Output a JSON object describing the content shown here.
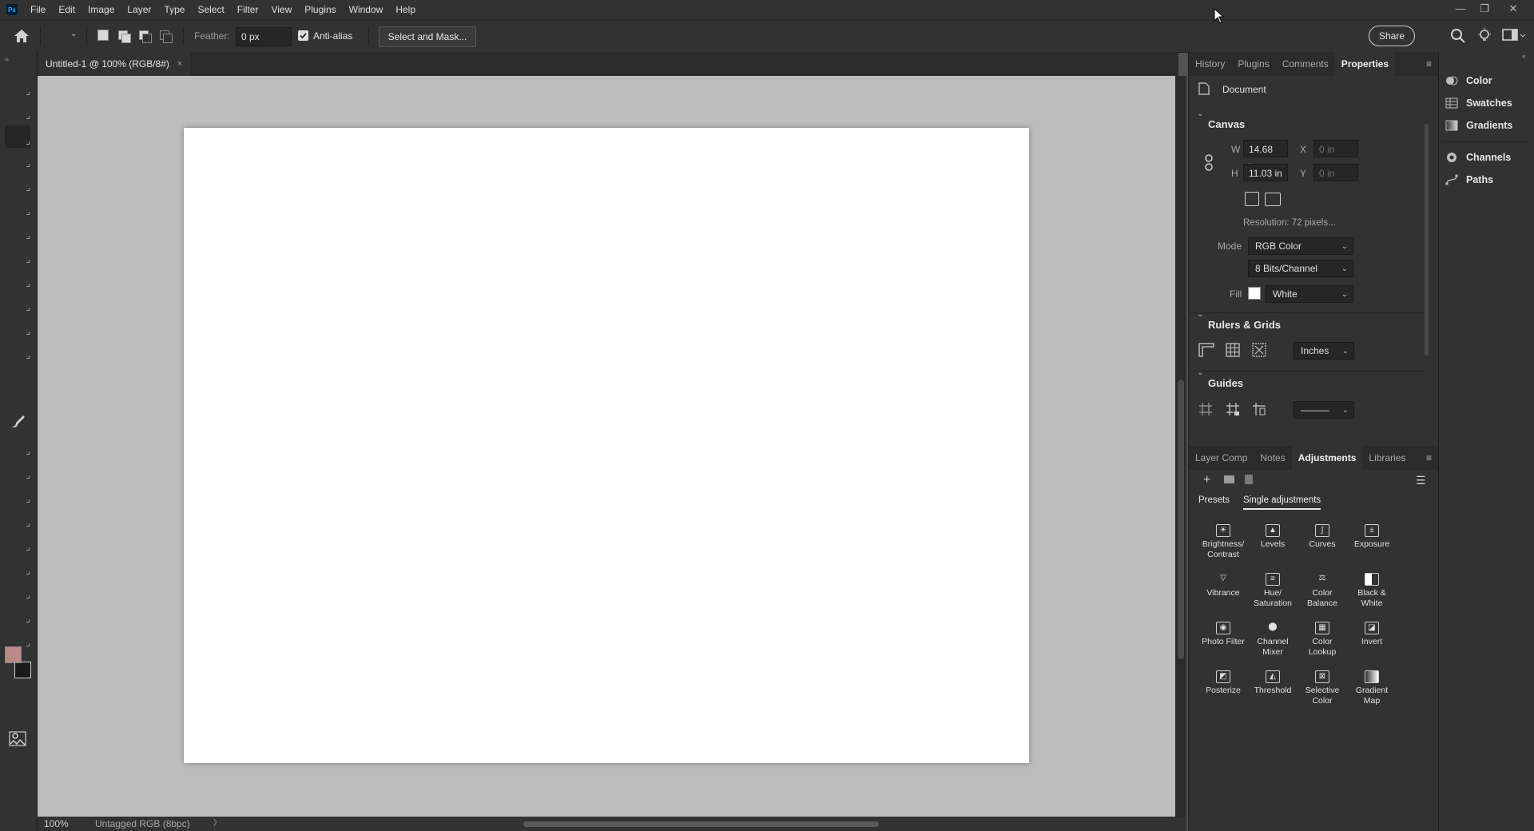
{
  "app": {
    "logo": "Ps"
  },
  "menu": [
    "File",
    "Edit",
    "Image",
    "Layer",
    "Type",
    "Select",
    "Filter",
    "View",
    "Plugins",
    "Window",
    "Help"
  ],
  "window_controls": {
    "minimize": "—",
    "restore": "❐",
    "close": "✕"
  },
  "options": {
    "feather_label": "Feather:",
    "feather_value": "0 px",
    "anti_alias_label": "Anti-alias",
    "anti_alias_checked": true,
    "select_mask_label": "Select and Mask...",
    "share_label": "Share"
  },
  "document": {
    "tab_title": "Untitled-1 @ 100% (RGB/8#)",
    "tab_close": "×",
    "canvas_color": "#ffffff",
    "pasteboard_color": "#bdbdbd"
  },
  "status": {
    "zoom": "100%",
    "profile": "Untagged RGB (8bpc)",
    "arrow": "〉"
  },
  "colors": {
    "foreground": "#b98a86",
    "background": "#1a1a1a",
    "accent": "#31a8ff"
  },
  "properties_panel": {
    "tabs": [
      "History",
      "Plugins",
      "Comments",
      "Properties"
    ],
    "active_tab": "Properties",
    "type_label": "Document",
    "canvas": {
      "title": "Canvas",
      "w_label": "W",
      "w_value": "14.68 in",
      "h_label": "H",
      "h_value": "11.03 in",
      "x_label": "X",
      "x_value": "0 in",
      "y_label": "Y",
      "y_value": "0 in",
      "resolution": "Resolution: 72 pixels...",
      "mode_label": "Mode",
      "mode_value": "RGB Color",
      "bits_value": "8 Bits/Channel",
      "fill_label": "Fill",
      "fill_value": "White"
    },
    "rulers": {
      "title": "Rulers & Grids",
      "units": "Inches"
    },
    "guides": {
      "title": "Guides",
      "style": "———"
    }
  },
  "adjustments_panel": {
    "tabs": [
      "Layer Comp",
      "Notes",
      "Adjustments",
      "Libraries"
    ],
    "active_tab": "Adjustments",
    "subtabs": [
      "Presets",
      "Single adjustments"
    ],
    "active_subtab": "Single adjustments",
    "items": [
      {
        "label": "Brightness/ Contrast",
        "icon": "brightness-icon"
      },
      {
        "label": "Levels",
        "icon": "levels-icon"
      },
      {
        "label": "Curves",
        "icon": "curves-icon"
      },
      {
        "label": "Exposure",
        "icon": "exposure-icon"
      },
      {
        "label": "Vibrance",
        "icon": "vibrance-icon"
      },
      {
        "label": "Hue/ Saturation",
        "icon": "hue-saturation-icon"
      },
      {
        "label": "Color Balance",
        "icon": "color-balance-icon"
      },
      {
        "label": "Black & White",
        "icon": "black-white-icon"
      },
      {
        "label": "Photo Filter",
        "icon": "photo-filter-icon"
      },
      {
        "label": "Channel Mixer",
        "icon": "channel-mixer-icon"
      },
      {
        "label": "Color Lookup",
        "icon": "color-lookup-icon"
      },
      {
        "label": "Invert",
        "icon": "invert-icon"
      },
      {
        "label": "Posterize",
        "icon": "posterize-icon"
      },
      {
        "label": "Threshold",
        "icon": "threshold-icon"
      },
      {
        "label": "Selective Color",
        "icon": "selective-color-icon"
      },
      {
        "label": "Gradient Map",
        "icon": "gradient-map-icon"
      }
    ]
  },
  "side_panel": {
    "items": [
      {
        "label": "Color",
        "icon": "color-icon"
      },
      {
        "label": "Swatches",
        "icon": "swatches-icon"
      },
      {
        "label": "Gradients",
        "icon": "gradients-icon"
      },
      {
        "label": "Channels",
        "icon": "channels-icon"
      },
      {
        "label": "Paths",
        "icon": "paths-icon"
      }
    ]
  }
}
